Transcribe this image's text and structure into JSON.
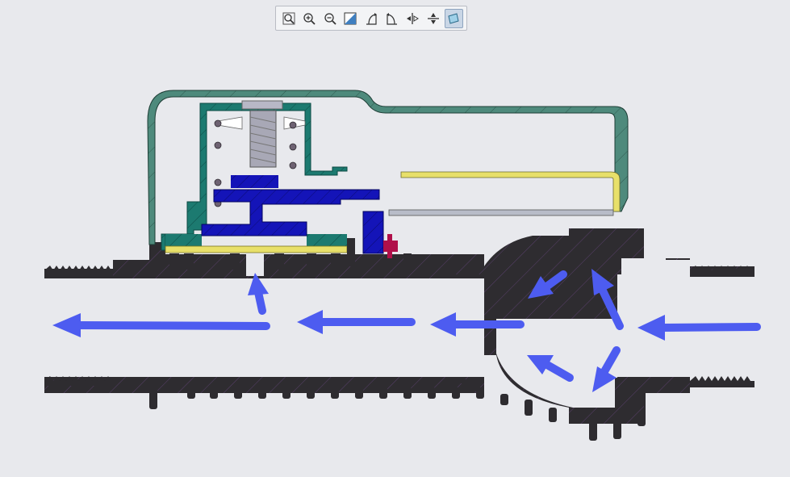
{
  "toolbar": {
    "buttons": [
      {
        "icon": "zoom-fit-icon",
        "active": false
      },
      {
        "icon": "zoom-in-icon",
        "active": false
      },
      {
        "icon": "zoom-out-icon",
        "active": false
      },
      {
        "icon": "zoom-area-icon",
        "active": false
      },
      {
        "icon": "rotate-left-icon",
        "active": false
      },
      {
        "icon": "rotate-right-icon",
        "active": false
      },
      {
        "icon": "mirror-horizontal-icon",
        "active": false
      },
      {
        "icon": "mirror-vertical-icon",
        "active": false
      },
      {
        "icon": "section-view-icon",
        "active": true
      }
    ]
  },
  "colors": {
    "background": "#e8e9ed",
    "body_dark": "#2e2c30",
    "cover_teal": "#4e8a7c",
    "inner_teal": "#1c7a70",
    "diaphragm_blue": "#1414b8",
    "gasket_yellow": "#e8e06a",
    "arrow_blue": "#4d5cf0",
    "spring_grey": "#9a9aa6",
    "pin_red": "#b0104a"
  }
}
